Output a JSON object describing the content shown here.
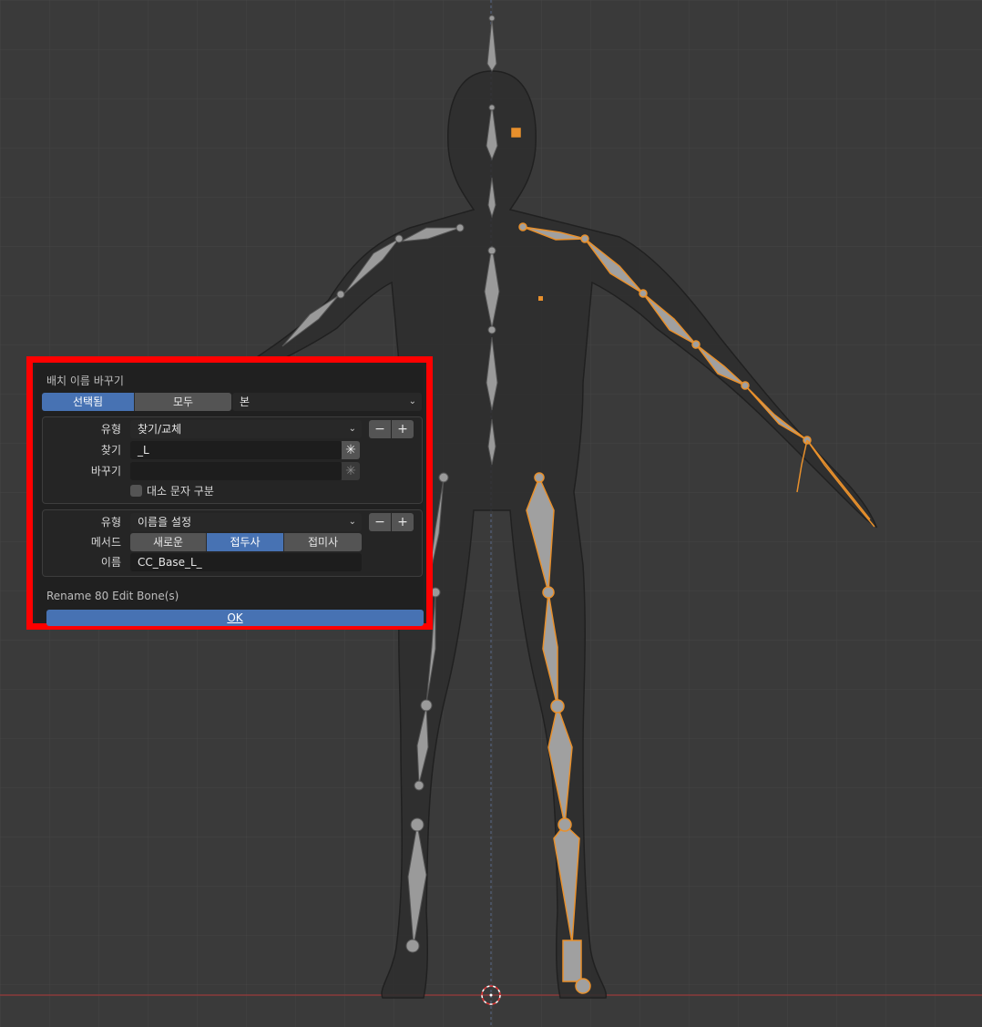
{
  "dialog": {
    "title": "배치 이름 바꾸기",
    "scope_tabs": [
      "선택됨",
      "모두"
    ],
    "scope_active": 0,
    "data_type": "본",
    "group1": {
      "type_label": "유형",
      "type_value": "찾기/교체",
      "find_label": "찾기",
      "find_value": "_L",
      "replace_label": "바꾸기",
      "replace_value": "",
      "case_label": "대소 문자 구분"
    },
    "group2": {
      "type_label": "유형",
      "type_value": "이름을 설정",
      "method_label": "메서드",
      "method_options": [
        "새로운",
        "접두사",
        "접미사"
      ],
      "method_active": 1,
      "name_label": "이름",
      "name_value": "CC_Base_L_"
    },
    "minus": "−",
    "plus": "+",
    "status": "Rename 80 Edit Bone(s)",
    "ok_label": "OK",
    "regex_icon": "asterisk-icon"
  },
  "colors": {
    "viewport_bg": "#3a3a3a",
    "grid": "#444444",
    "bone": "#9a9a9a",
    "bone_selected": "#e8902c",
    "accent": "#4772b3",
    "highlight_frame": "#ff0000"
  }
}
